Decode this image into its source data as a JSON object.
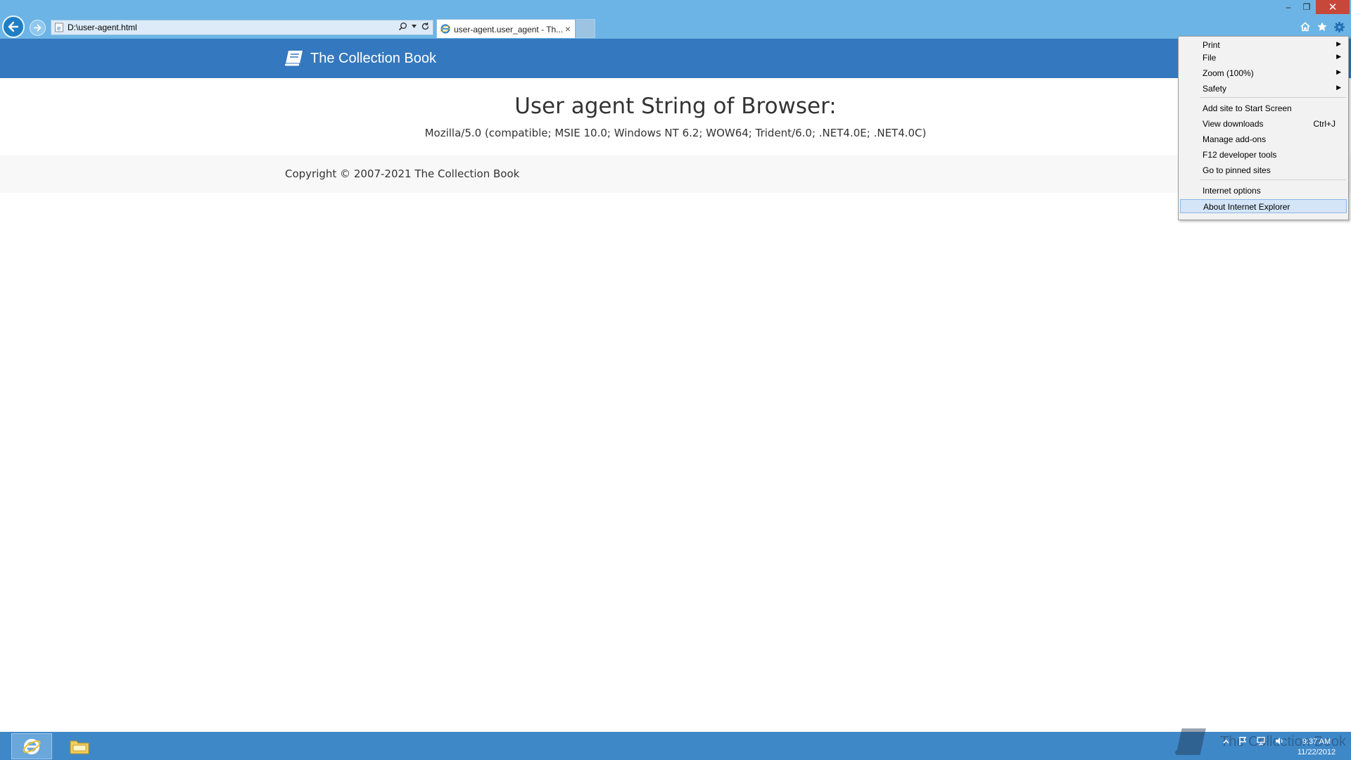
{
  "browser": {
    "address_url": "D:\\user-agent.html",
    "tab_title": "user-agent.user_agent - Th...",
    "tab_close": "×",
    "window_min": "–",
    "window_restore": "❐",
    "window_close": "✕"
  },
  "site": {
    "brand": "The Collection Book",
    "heading": "User agent String of Browser:",
    "user_agent": "Mozilla/5.0 (compatible; MSIE 10.0; Windows NT 6.2; WOW64; Trident/6.0; .NET4.0E; .NET4.0C)",
    "copyright": "Copyright © 2007-2021 The Collection Book"
  },
  "tools_menu": {
    "items": [
      {
        "label": "Print",
        "submenu": true
      },
      {
        "label": "File",
        "submenu": true
      },
      {
        "label": "Zoom (100%)",
        "submenu": true
      },
      {
        "label": "Safety",
        "submenu": true
      },
      {
        "label": "Add site to Start Screen"
      },
      {
        "label": "View downloads",
        "shortcut": "Ctrl+J"
      },
      {
        "label": "Manage add-ons"
      },
      {
        "label": "F12 developer tools"
      },
      {
        "label": "Go to pinned sites"
      },
      {
        "label": "Internet options"
      },
      {
        "label": "About Internet Explorer",
        "highlighted": true
      }
    ],
    "arrow_glyph": "▶"
  },
  "taskbar": {
    "watermark": "The Collection Book",
    "clock_time": "9:37 AM",
    "clock_date": "11/22/2012"
  },
  "colors": {
    "chrome": "#6cb4e5",
    "site_header": "#3478bf",
    "taskbar": "#3f88c8",
    "menu_highlight": "#d3e5f7"
  }
}
